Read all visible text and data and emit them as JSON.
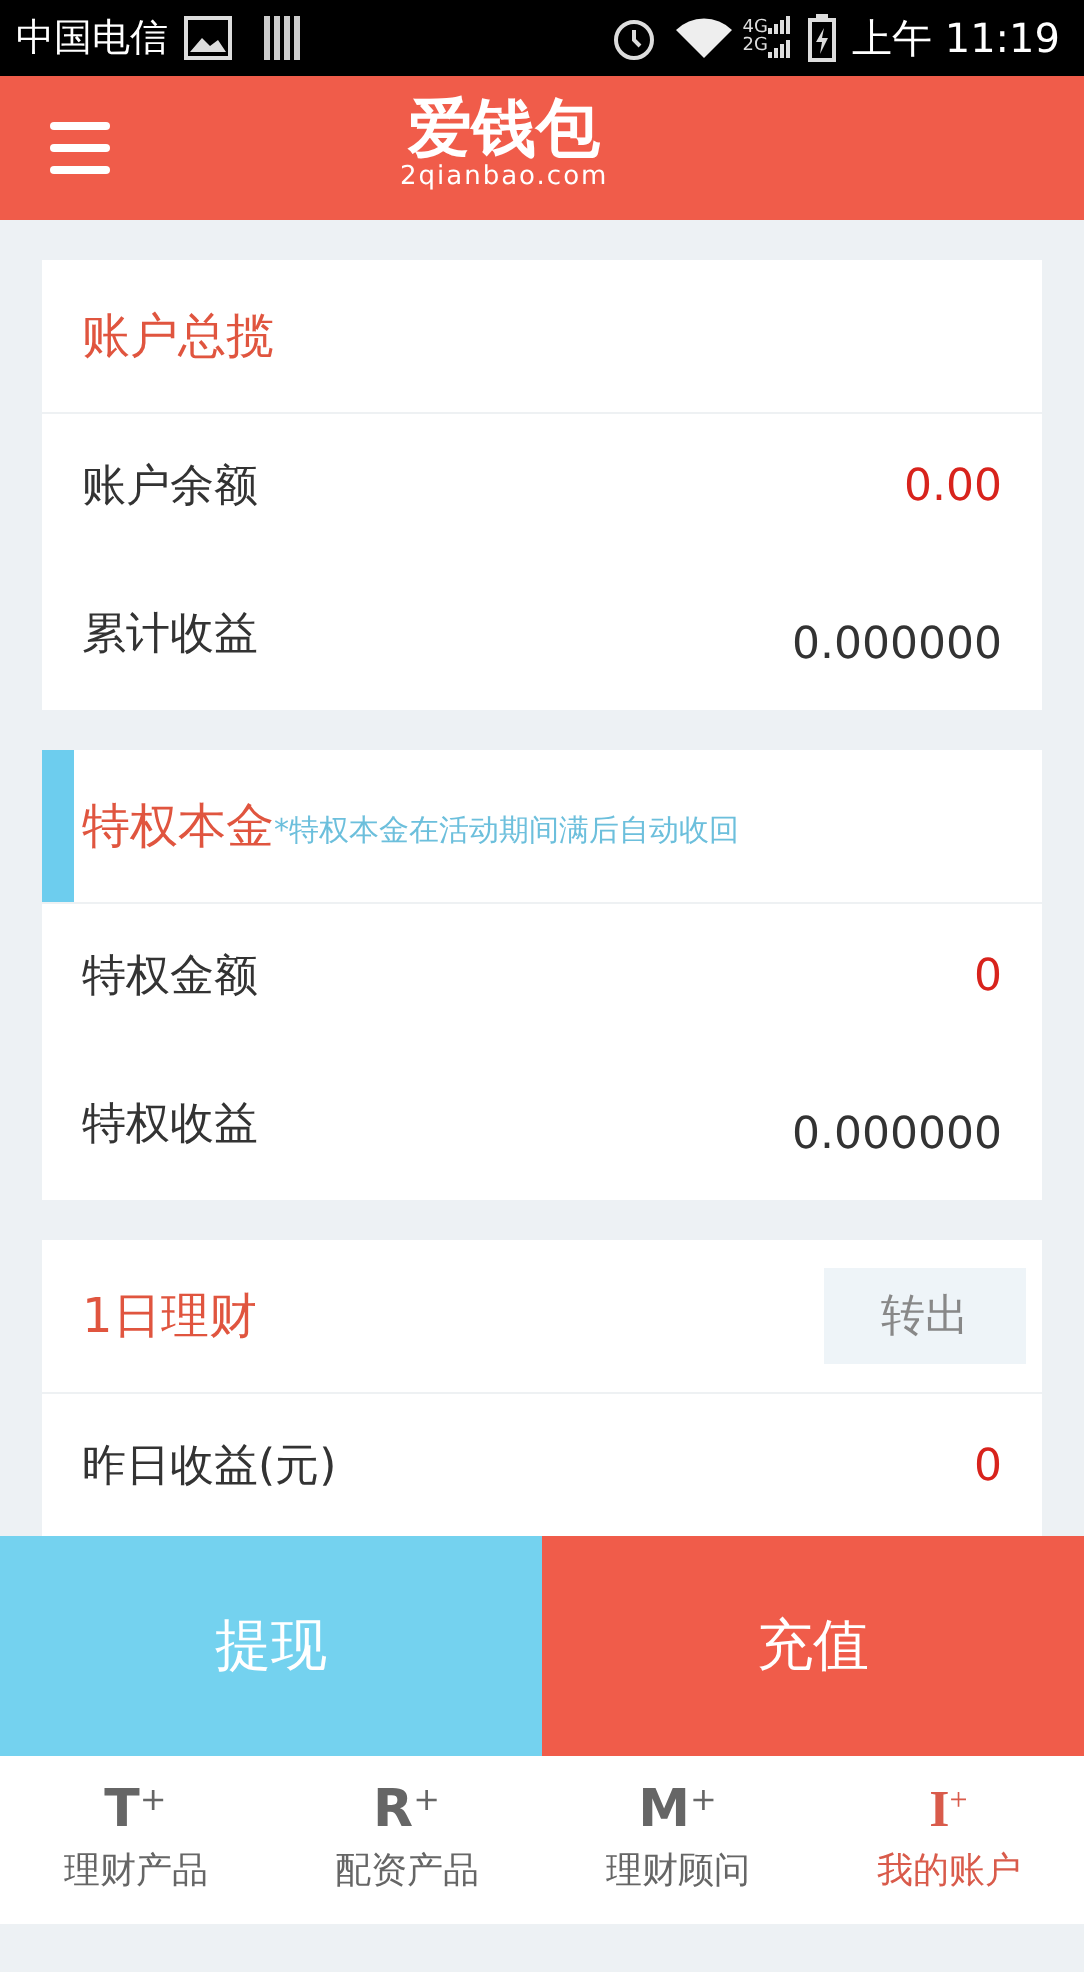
{
  "status_bar": {
    "carrier": "中国电信",
    "network_labels": [
      "4G",
      "2G"
    ],
    "time": "上午 11:19"
  },
  "header": {
    "logo": "爱钱包",
    "logo_domain": "2qianbao.com"
  },
  "cards": [
    {
      "title": "账户总揽",
      "accent": false,
      "rows": [
        {
          "label": "账户余额",
          "value": "0.00",
          "highlight": true
        },
        {
          "label": "累计收益",
          "value": "0.000000",
          "highlight": false
        }
      ]
    },
    {
      "title": "特权本金",
      "note": "*特权本金在活动期间满后自动收回",
      "accent": true,
      "rows": [
        {
          "label": "特权金额",
          "value": "0",
          "highlight": true
        },
        {
          "label": "特权收益",
          "value": "0.000000",
          "highlight": false
        }
      ]
    },
    {
      "title": "1日理财",
      "accent": false,
      "action": "转出",
      "rows": [
        {
          "label": "昨日收益(元)",
          "value": "0",
          "highlight": true
        }
      ]
    }
  ],
  "actions": [
    {
      "label": "提现",
      "kind": "withdraw"
    },
    {
      "label": "充值",
      "kind": "recharge"
    }
  ],
  "tabs": [
    {
      "letter": "T",
      "sup": "+",
      "label": "理财产品",
      "selected": false
    },
    {
      "letter": "R",
      "sup": "+",
      "label": "配资产品",
      "selected": false
    },
    {
      "letter": "M",
      "sup": "+",
      "label": "理财顾问",
      "selected": false
    },
    {
      "letter": "I",
      "sup": "+",
      "label": "我的账户",
      "selected": true
    }
  ]
}
